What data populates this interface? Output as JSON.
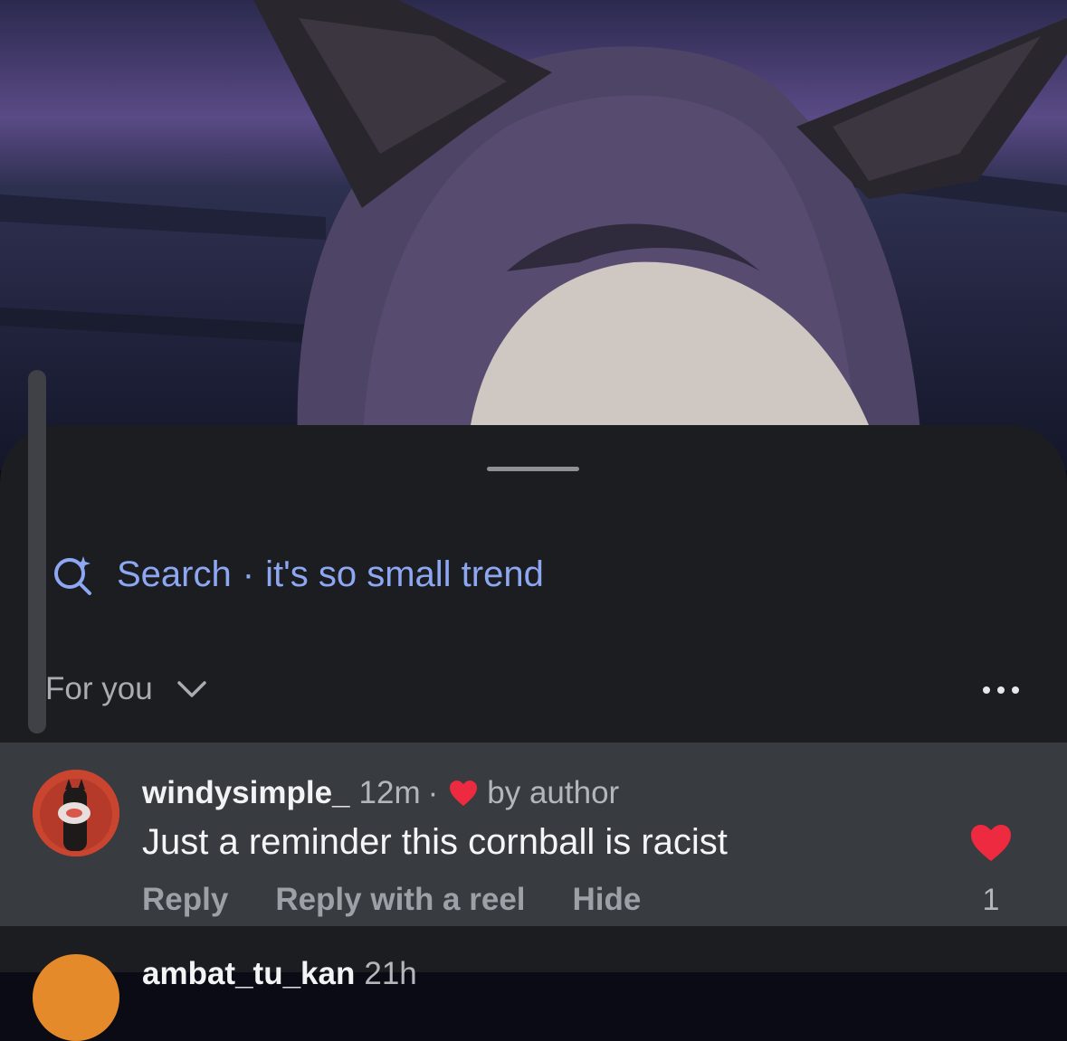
{
  "search": {
    "label": "Search",
    "separator": "·",
    "query": "it's so small trend"
  },
  "sort": {
    "label": "For you"
  },
  "comment": {
    "username": "windysimple_",
    "time": "12m",
    "separator": "·",
    "liked_by": "by author",
    "text": "Just a reminder this cornball is racist",
    "actions": {
      "reply": "Reply",
      "reply_reel": "Reply with a reel",
      "hide": "Hide"
    },
    "like_count": "1"
  },
  "next_comment": {
    "username": "ambat_tu_kan",
    "time": "21h"
  },
  "colors": {
    "sheet": "#1c1d21",
    "highlight_row": "#383b40",
    "search_accent": "#8ea7f3",
    "like_red": "#ed2a3f"
  }
}
